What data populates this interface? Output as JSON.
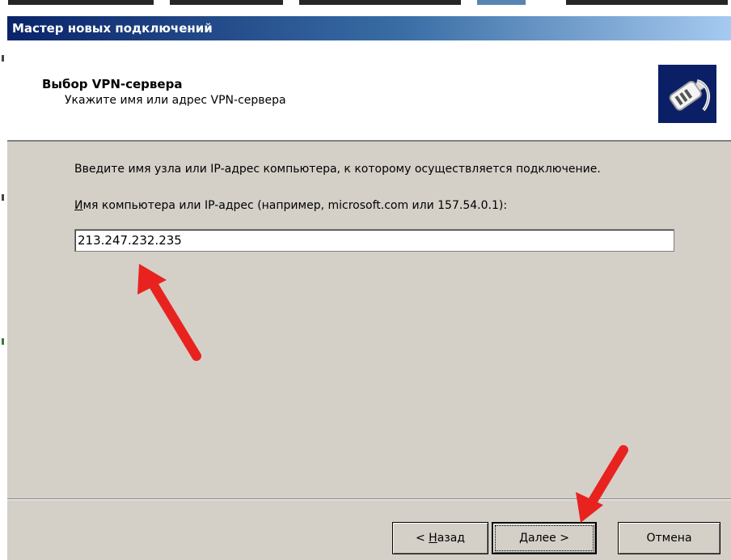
{
  "window": {
    "title": "Мастер новых подключений"
  },
  "header": {
    "title": "Выбор VPN-сервера",
    "subtitle": "Укажите имя или адрес VPN-сервера",
    "icon": "vpn-plug-icon"
  },
  "content": {
    "intro_text": "Введите имя узла или IP-адрес компьютера, к  которому осуществляется подключение.",
    "field_label_mnemonic": "И",
    "field_label_rest": "мя компьютера или IP-адрес (например, microsoft.com или 157.54.0.1):",
    "ip_value": "213.247.232.235"
  },
  "buttons": {
    "back_prefix": "< ",
    "back_mnemonic": "Н",
    "back_rest": "азад",
    "next_mnemonic": "Д",
    "next_rest": "алее >",
    "cancel_label": "Отмена"
  },
  "annotations": {
    "arrow_color": "#e8231f"
  }
}
